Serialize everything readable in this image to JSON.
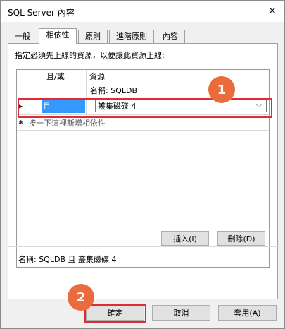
{
  "window": {
    "title": "SQL Server 內容",
    "close_glyph": "✕"
  },
  "tabs": [
    {
      "label": "一般"
    },
    {
      "label": "相依性"
    },
    {
      "label": "原則"
    },
    {
      "label": "進階原則"
    },
    {
      "label": "內容"
    }
  ],
  "active_tab": "相依性",
  "dependencies": {
    "instruction": "指定必須先上線的資源，以便讓此資源上線:",
    "columns": {
      "and_or": "且/或",
      "resource": "資源"
    },
    "rows": [
      {
        "and_or": "",
        "resource": "名稱: SQLDB",
        "row_marker": ""
      },
      {
        "and_or": "且",
        "resource": "叢集磁碟 4",
        "row_marker": "▶"
      }
    ],
    "new_row": {
      "marker": "✱",
      "hint": "按一下這裡新增相依性"
    },
    "insert_label": "插入(I)",
    "delete_label": "刪除(D)",
    "summary": "名稱: SQLDB 且 叢集磁碟 4"
  },
  "buttons": {
    "ok": "確定",
    "cancel": "取消",
    "apply": "套用(A)"
  },
  "callouts": [
    {
      "label": "1"
    },
    {
      "label": "2"
    }
  ],
  "colors": {
    "callout_fill": "#ea6b3b",
    "highlight_border": "#e02b36",
    "selection": "#3399ff"
  }
}
